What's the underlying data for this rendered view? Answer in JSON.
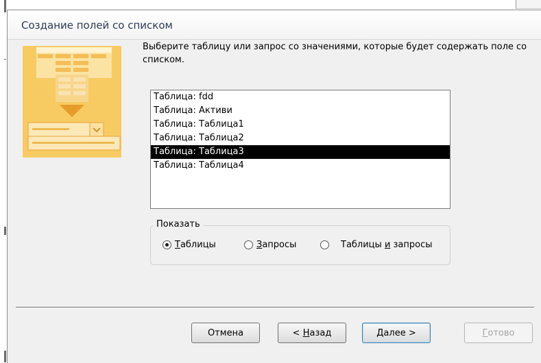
{
  "dialog": {
    "title": "Создание полей со списком",
    "prompt": "Выберите таблицу или запрос со значениями, которые будет содержать поле со списком."
  },
  "list": {
    "items": [
      "Таблица: fdd",
      "Таблица: Активи",
      "Таблица: Таблица1",
      "Таблица: Таблица2",
      "Таблица: Таблица3",
      "Таблица: Таблица4"
    ],
    "selected": "Таблица: Таблица3"
  },
  "show": {
    "label": "Показать",
    "options": {
      "tables": {
        "mnemonic": "Т",
        "rest": "аблицы",
        "checked": true
      },
      "queries": {
        "mnemonic": "З",
        "rest": "апросы",
        "checked": false
      },
      "both": {
        "before": "Таблицы ",
        "mnemonic": "и",
        "after": " запросы",
        "checked": false
      }
    }
  },
  "buttons": {
    "cancel": "Отмена",
    "back": {
      "before": "< ",
      "mnemonic": "Н",
      "after": "азад"
    },
    "next": {
      "mnemonic": "Д",
      "after": "алее >"
    },
    "finish": {
      "mnemonic": "Г",
      "after": "отово"
    }
  },
  "colors": {
    "illustration_orange": "#f7c85a",
    "illustration_dark": "#e8a427",
    "selection": "#000000",
    "default_button_border": "#3c7fb1"
  },
  "icons": {
    "wizard_illustration": "combo-box-wizard-icon"
  }
}
